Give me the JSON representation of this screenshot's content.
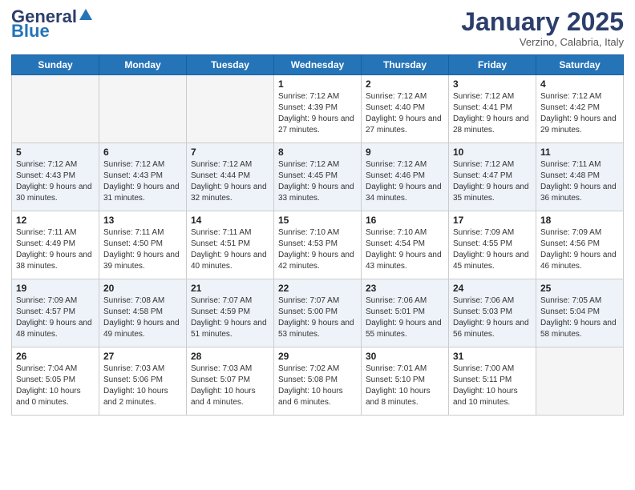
{
  "logo": {
    "general": "General",
    "blue": "Blue"
  },
  "header": {
    "month": "January 2025",
    "location": "Verzino, Calabria, Italy"
  },
  "days_of_week": [
    "Sunday",
    "Monday",
    "Tuesday",
    "Wednesday",
    "Thursday",
    "Friday",
    "Saturday"
  ],
  "weeks": [
    [
      {
        "day": "",
        "info": ""
      },
      {
        "day": "",
        "info": ""
      },
      {
        "day": "",
        "info": ""
      },
      {
        "day": "1",
        "info": "Sunrise: 7:12 AM\nSunset: 4:39 PM\nDaylight: 9 hours and 27 minutes."
      },
      {
        "day": "2",
        "info": "Sunrise: 7:12 AM\nSunset: 4:40 PM\nDaylight: 9 hours and 27 minutes."
      },
      {
        "day": "3",
        "info": "Sunrise: 7:12 AM\nSunset: 4:41 PM\nDaylight: 9 hours and 28 minutes."
      },
      {
        "day": "4",
        "info": "Sunrise: 7:12 AM\nSunset: 4:42 PM\nDaylight: 9 hours and 29 minutes."
      }
    ],
    [
      {
        "day": "5",
        "info": "Sunrise: 7:12 AM\nSunset: 4:43 PM\nDaylight: 9 hours and 30 minutes."
      },
      {
        "day": "6",
        "info": "Sunrise: 7:12 AM\nSunset: 4:43 PM\nDaylight: 9 hours and 31 minutes."
      },
      {
        "day": "7",
        "info": "Sunrise: 7:12 AM\nSunset: 4:44 PM\nDaylight: 9 hours and 32 minutes."
      },
      {
        "day": "8",
        "info": "Sunrise: 7:12 AM\nSunset: 4:45 PM\nDaylight: 9 hours and 33 minutes."
      },
      {
        "day": "9",
        "info": "Sunrise: 7:12 AM\nSunset: 4:46 PM\nDaylight: 9 hours and 34 minutes."
      },
      {
        "day": "10",
        "info": "Sunrise: 7:12 AM\nSunset: 4:47 PM\nDaylight: 9 hours and 35 minutes."
      },
      {
        "day": "11",
        "info": "Sunrise: 7:11 AM\nSunset: 4:48 PM\nDaylight: 9 hours and 36 minutes."
      }
    ],
    [
      {
        "day": "12",
        "info": "Sunrise: 7:11 AM\nSunset: 4:49 PM\nDaylight: 9 hours and 38 minutes."
      },
      {
        "day": "13",
        "info": "Sunrise: 7:11 AM\nSunset: 4:50 PM\nDaylight: 9 hours and 39 minutes."
      },
      {
        "day": "14",
        "info": "Sunrise: 7:11 AM\nSunset: 4:51 PM\nDaylight: 9 hours and 40 minutes."
      },
      {
        "day": "15",
        "info": "Sunrise: 7:10 AM\nSunset: 4:53 PM\nDaylight: 9 hours and 42 minutes."
      },
      {
        "day": "16",
        "info": "Sunrise: 7:10 AM\nSunset: 4:54 PM\nDaylight: 9 hours and 43 minutes."
      },
      {
        "day": "17",
        "info": "Sunrise: 7:09 AM\nSunset: 4:55 PM\nDaylight: 9 hours and 45 minutes."
      },
      {
        "day": "18",
        "info": "Sunrise: 7:09 AM\nSunset: 4:56 PM\nDaylight: 9 hours and 46 minutes."
      }
    ],
    [
      {
        "day": "19",
        "info": "Sunrise: 7:09 AM\nSunset: 4:57 PM\nDaylight: 9 hours and 48 minutes."
      },
      {
        "day": "20",
        "info": "Sunrise: 7:08 AM\nSunset: 4:58 PM\nDaylight: 9 hours and 49 minutes."
      },
      {
        "day": "21",
        "info": "Sunrise: 7:07 AM\nSunset: 4:59 PM\nDaylight: 9 hours and 51 minutes."
      },
      {
        "day": "22",
        "info": "Sunrise: 7:07 AM\nSunset: 5:00 PM\nDaylight: 9 hours and 53 minutes."
      },
      {
        "day": "23",
        "info": "Sunrise: 7:06 AM\nSunset: 5:01 PM\nDaylight: 9 hours and 55 minutes."
      },
      {
        "day": "24",
        "info": "Sunrise: 7:06 AM\nSunset: 5:03 PM\nDaylight: 9 hours and 56 minutes."
      },
      {
        "day": "25",
        "info": "Sunrise: 7:05 AM\nSunset: 5:04 PM\nDaylight: 9 hours and 58 minutes."
      }
    ],
    [
      {
        "day": "26",
        "info": "Sunrise: 7:04 AM\nSunset: 5:05 PM\nDaylight: 10 hours and 0 minutes."
      },
      {
        "day": "27",
        "info": "Sunrise: 7:03 AM\nSunset: 5:06 PM\nDaylight: 10 hours and 2 minutes."
      },
      {
        "day": "28",
        "info": "Sunrise: 7:03 AM\nSunset: 5:07 PM\nDaylight: 10 hours and 4 minutes."
      },
      {
        "day": "29",
        "info": "Sunrise: 7:02 AM\nSunset: 5:08 PM\nDaylight: 10 hours and 6 minutes."
      },
      {
        "day": "30",
        "info": "Sunrise: 7:01 AM\nSunset: 5:10 PM\nDaylight: 10 hours and 8 minutes."
      },
      {
        "day": "31",
        "info": "Sunrise: 7:00 AM\nSunset: 5:11 PM\nDaylight: 10 hours and 10 minutes."
      },
      {
        "day": "",
        "info": ""
      }
    ]
  ]
}
